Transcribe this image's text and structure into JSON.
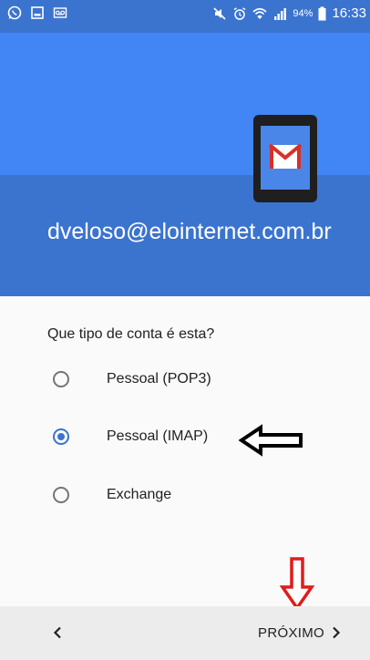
{
  "status_bar": {
    "battery_percent": "94%",
    "time": "16:33",
    "left_icons": [
      "whatsapp-icon",
      "gallery-icon",
      "voicemail-icon"
    ],
    "right_icons": [
      "mute-icon",
      "alarm-icon",
      "wifi-icon",
      "signal-icon",
      "battery-icon"
    ]
  },
  "header": {
    "account_email": "dveloso@elointernet.com.br",
    "illustration": "gmail-phone-icon",
    "accent_color": "#4285f4",
    "dark_color": "#3b74cf"
  },
  "form": {
    "question": "Que tipo de conta é esta?",
    "options": [
      {
        "label": "Pessoal (POP3)",
        "selected": false
      },
      {
        "label": "Pessoal (IMAP)",
        "selected": true
      },
      {
        "label": "Exchange",
        "selected": false
      }
    ]
  },
  "annotations": {
    "black_arrow": "arrow-left-outline-icon",
    "red_arrow": "arrow-down-outline-icon"
  },
  "bottom_bar": {
    "back_icon": "chevron-left-icon",
    "next_label": "PRÓXIMO",
    "next_icon": "chevron-right-icon"
  }
}
